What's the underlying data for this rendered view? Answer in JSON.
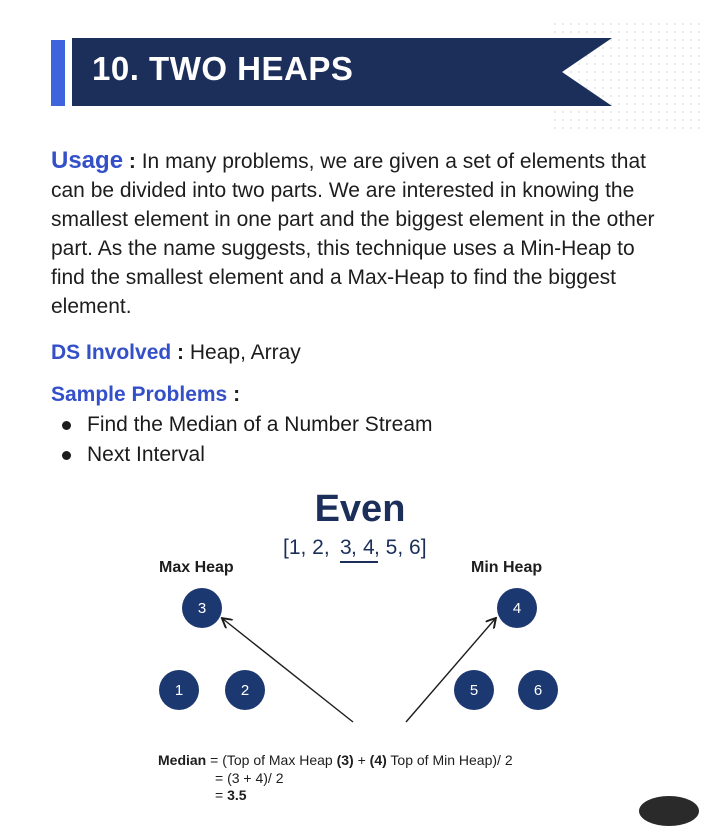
{
  "header": {
    "title": "10. TWO HEAPS"
  },
  "usage": {
    "label": "Usage",
    "sep": " : ",
    "text": "In many problems, we are given a set of elements that can be divided into two parts. We are interested in knowing the smallest element in one part and the biggest element in the other part. As the name suggests, this technique uses a Min-Heap to find the smallest element and a Max-Heap to find the biggest element."
  },
  "ds": {
    "label": "DS Involved",
    "sep": " : ",
    "value": "Heap, Array"
  },
  "sample": {
    "label": "Sample Problems",
    "sep": " :",
    "items": [
      "Find the Median of a Number Stream",
      "Next Interval"
    ]
  },
  "diagram": {
    "title": "Even",
    "array": {
      "open": "[1, 2, ",
      "mid1": "3",
      "comma": ", ",
      "mid2": "4",
      "close": ", 5, 6]"
    },
    "max_heap": {
      "label": "Max Heap",
      "top": "3",
      "children": [
        "1",
        "2"
      ]
    },
    "min_heap": {
      "label": "Min Heap",
      "top": "4",
      "children": [
        "5",
        "6"
      ]
    },
    "formula": {
      "label": "Median",
      "line1_pre": " = (Top of Max Heap ",
      "max_val": "(3)",
      "plus": " + ",
      "min_val": "(4)",
      "line1_post": " Top of Min Heap)/ 2",
      "line2": "= (3 + 4)/ 2",
      "line3_eq": "= ",
      "result": "3.5"
    }
  },
  "colors": {
    "banner": "#1c2f5b",
    "accent": "#3d63dd",
    "highlight": "#3350c9",
    "node": "#1c3870"
  }
}
